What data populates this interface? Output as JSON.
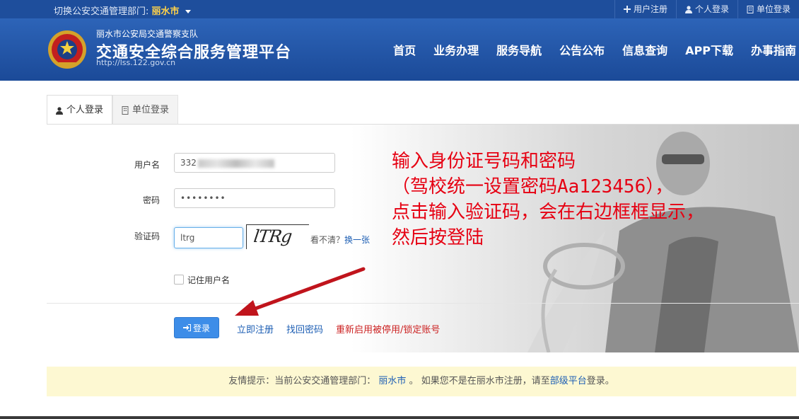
{
  "topbar": {
    "switch_label": "切换公安交通管理部门:",
    "city": "丽水市",
    "links": [
      {
        "icon": "plus-icon",
        "label": "用户注册"
      },
      {
        "icon": "user-icon",
        "label": "个人登录"
      },
      {
        "icon": "building-icon",
        "label": "单位登录"
      }
    ]
  },
  "header": {
    "subtitle": "丽水市公安局交通警察支队",
    "title": "交通安全综合服务管理平台",
    "url": "http://lss.122.gov.cn",
    "nav": [
      "首页",
      "业务办理",
      "服务导航",
      "公告公布",
      "信息查询",
      "APP下载",
      "办事指南"
    ]
  },
  "tabs": [
    {
      "icon": "user-icon",
      "label": "个人登录",
      "active": true
    },
    {
      "icon": "building-icon",
      "label": "单位登录",
      "active": false
    }
  ],
  "form": {
    "username_label": "用户名",
    "username_value": "332",
    "password_label": "密码",
    "password_value": "••••••••",
    "captcha_label": "验证码",
    "captcha_value": "ltrg",
    "captcha_image_text": "lTRg",
    "unclear_text": "看不清？",
    "refresh_link": "换一张",
    "remember_label": "记住用户名"
  },
  "actions": {
    "login_button": "登录",
    "register_link": "立即注册",
    "recover_link": "找回密码",
    "reactivate_link": "重新启用被停用/锁定账号"
  },
  "annotation": {
    "lines": [
      "输入身份证号码和密码",
      "（驾校统一设置密码Aa123456），",
      "点击输入验证码，会在右边框框显示，",
      "然后按登陆"
    ],
    "color": "#e60012"
  },
  "notice": {
    "prefix": "友情提示：当前公安交通管理部门：",
    "city": "丽水市",
    "middle": "。 如果您不是在丽水市注册，请至",
    "link": "部级平台",
    "suffix": "登录。"
  },
  "colors": {
    "header_blue": "#1e4e9c",
    "button_blue": "#3d8de8",
    "notice_bg": "#fdf8d2"
  }
}
